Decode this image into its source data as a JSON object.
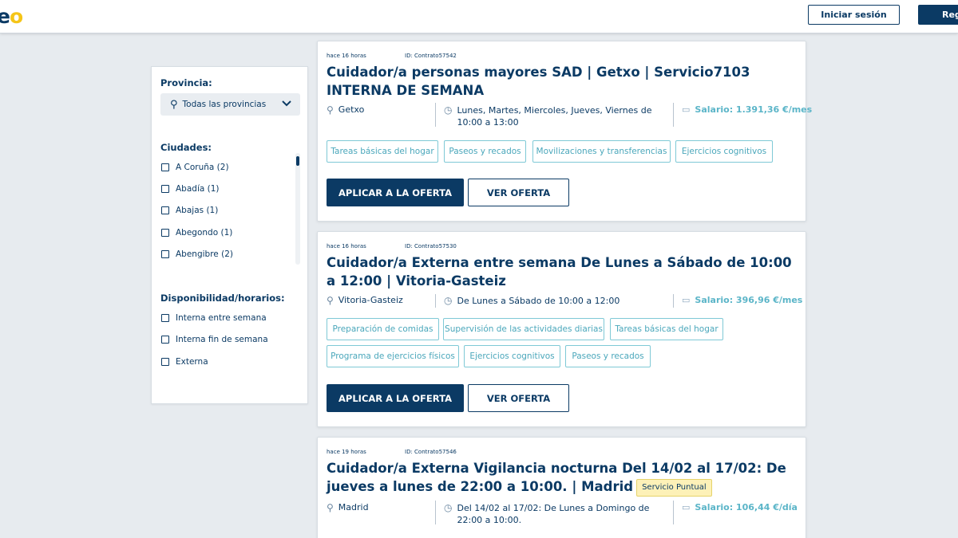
{
  "header": {
    "logo_main": "e",
    "logo_accent": "o",
    "login_label": "Iniciar sesión",
    "register_label": "Reg"
  },
  "sidebar": {
    "province_label": "Provincia:",
    "province_select": "Todas las provincias",
    "cities_label": "Ciudades:",
    "cities": [
      "A Coruña (2)",
      "Abadía (1)",
      "Abajas (1)",
      "Abegondo (1)",
      "Abengibre (2)"
    ],
    "availability_label": "Disponibilidad/horarios:",
    "availability": [
      "Interna entre semana",
      "Interna fin de semana",
      "Externa"
    ]
  },
  "jobs": [
    {
      "posted": "hace 16 horas",
      "id": "ID: Contrato57542",
      "title": "Cuidador/a personas mayores SAD | Getxo | Servicio7103 INTERNA DE SEMANA",
      "location": "Getxo",
      "schedule": "Lunes, Martes, Miercoles, Jueves, Viernes de 10:00 a 13:00",
      "salary": "Salario: 1.391,36 €/mes",
      "tags": [
        "Tareas básicas del hogar",
        "Paseos y recados",
        "Movilizaciones y transferencias",
        "Ejercicios cognitivos"
      ],
      "apply_label": "APLICAR A LA OFERTA",
      "view_label": "VER OFERTA"
    },
    {
      "posted": "hace 16 horas",
      "id": "ID: Contrato57530",
      "title": "Cuidador/a Externa entre semana De Lunes a Sábado de 10:00 a 12:00 | Vitoria-Gasteiz",
      "location": "Vitoria-Gasteiz",
      "schedule": "De Lunes a Sábado de 10:00 a 12:00",
      "salary": "Salario: 396,96 €/mes",
      "tags": [
        "Preparación de comidas",
        "Supervisión de las actividades diarias",
        "Tareas básicas del hogar",
        "Programa de ejercicios físicos",
        "Ejercicios cognitivos",
        "Paseos y recados"
      ],
      "apply_label": "APLICAR A LA OFERTA",
      "view_label": "VER OFERTA"
    },
    {
      "posted": "hace 19 horas",
      "id": "ID: Contrato57546",
      "title": "Cuidador/a Externa Vigilancia nocturna Del 14/02 al 17/02: De jueves a lunes de 22:00 a 10:00. | Madrid",
      "badge": "Servicio Puntual",
      "location": "Madrid",
      "schedule": "Del 14/02 al 17/02: De Lunes a Domingo de 22:00 a 10:00.",
      "salary": "Salario: 106,44 €/día"
    }
  ]
}
